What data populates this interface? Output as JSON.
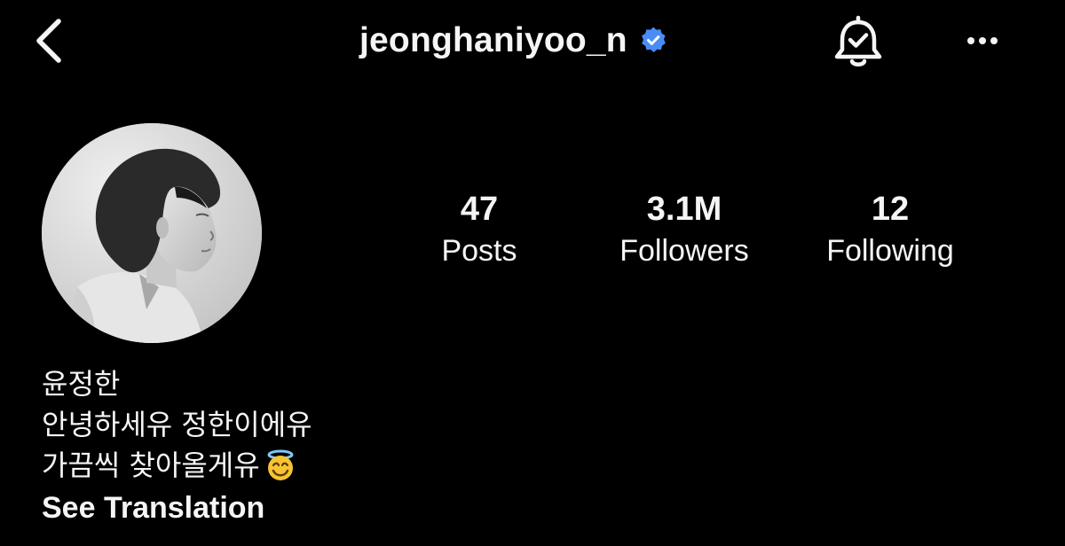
{
  "header": {
    "back_icon": "chevron-left-icon",
    "username": "jeonghaniyoo_n",
    "verified_icon": "verified-badge-icon",
    "verified_color": "#4a8cf7",
    "notification_icon": "bell-check-icon",
    "more_icon": "more-horizontal-icon"
  },
  "profile": {
    "avatar_alt": "avatar"
  },
  "stats": {
    "posts": {
      "value": "47",
      "label": "Posts"
    },
    "followers": {
      "value": "3.1M",
      "label": "Followers"
    },
    "following": {
      "value": "12",
      "label": "Following"
    }
  },
  "bio": {
    "name": "윤정한",
    "line1": "안녕하세유 정한이에유",
    "line2": "가끔씩 찾아올게유",
    "line2_emoji": "smiling-face-with-halo-icon",
    "see_translation": "See Translation"
  },
  "colors": {
    "background": "#000000",
    "text": "#f5f5f5",
    "accent": "#4a8cf7"
  }
}
